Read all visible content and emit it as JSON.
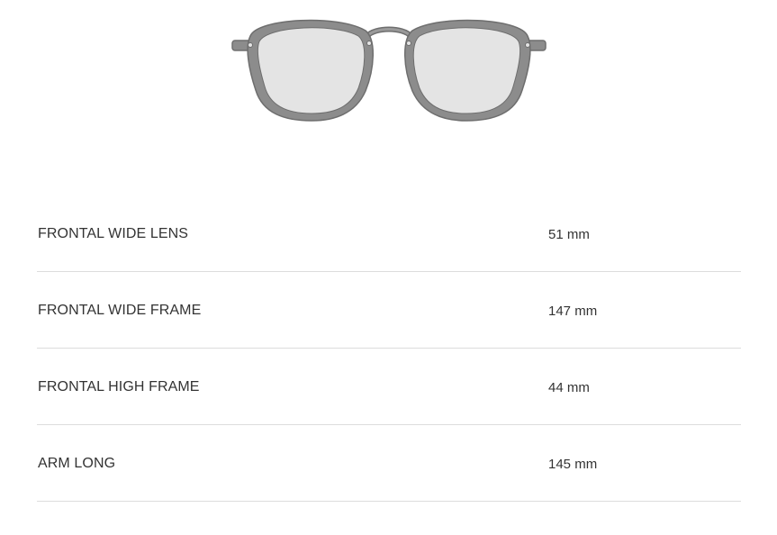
{
  "product_image": {
    "icon": "eyeglasses-icon",
    "frame_color": "#8c8c8c",
    "lens_color": "#e4e4e4",
    "outline_color": "#6e6e6e"
  },
  "specs": [
    {
      "label": "FRONTAL WIDE LENS",
      "value": "51 mm"
    },
    {
      "label": "FRONTAL WIDE FRAME",
      "value": "147 mm"
    },
    {
      "label": "FRONTAL HIGH FRAME",
      "value": "44 mm"
    },
    {
      "label": "ARM LONG",
      "value": "145 mm"
    }
  ]
}
